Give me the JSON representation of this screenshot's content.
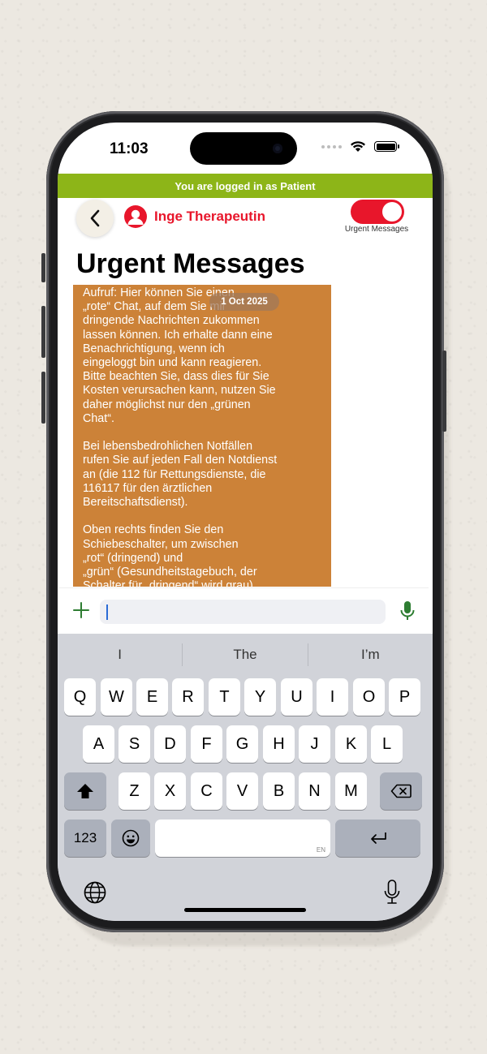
{
  "status_bar": {
    "time": "11:03"
  },
  "banner": {
    "text": "You are logged in as Patient"
  },
  "header": {
    "contact_name": "Inge Therapeutin",
    "toggle_label": "Urgent Messages",
    "toggle_on": true
  },
  "page": {
    "title": "Urgent Messages"
  },
  "message": {
    "date": "1 Oct 2025",
    "text": "Aufruf: Hier können Sie einen\n„rote“ Chat, auf dem Sie mir\ndringende Nachrichten zukommen\nlassen können. Ich erhalte dann eine\nBenachrichtigung, wenn ich\neingeloggt bin und kann reagieren.\nBitte beachten Sie, dass dies für Sie\nKosten verursachen kann, nutzen Sie\ndaher möglichst nur den „grünen\nChat“.\n\nBei lebensbedrohlichen Notfällen\nrufen Sie auf jeden Fall den Notdienst\nan (die 112 für Rettungsdienste, die\n116117 für den ärztlichen\nBereitschaftsdienst).\n\nOben rechts finden Sie den\nSchiebeschalter, um zwischen\n„rot“ (dringend) und\n„grün“ (Gesundheitstagebuch, der\nSchalter für „dringend“ wird grau)",
    "bubble_color": "#cc8238"
  },
  "composer": {
    "value": ""
  },
  "keyboard": {
    "suggestions": [
      "I",
      "The",
      "I’m"
    ],
    "row1": [
      "Q",
      "W",
      "E",
      "R",
      "T",
      "Y",
      "U",
      "I",
      "O",
      "P"
    ],
    "row2": [
      "A",
      "S",
      "D",
      "F",
      "G",
      "H",
      "J",
      "K",
      "L"
    ],
    "row3": [
      "Z",
      "X",
      "C",
      "V",
      "B",
      "N",
      "M"
    ],
    "numbers_key": "123",
    "space_language": "EN"
  },
  "colors": {
    "accent_red": "#e8162b",
    "banner_green": "#8db518",
    "mic_green": "#2e7d32"
  }
}
